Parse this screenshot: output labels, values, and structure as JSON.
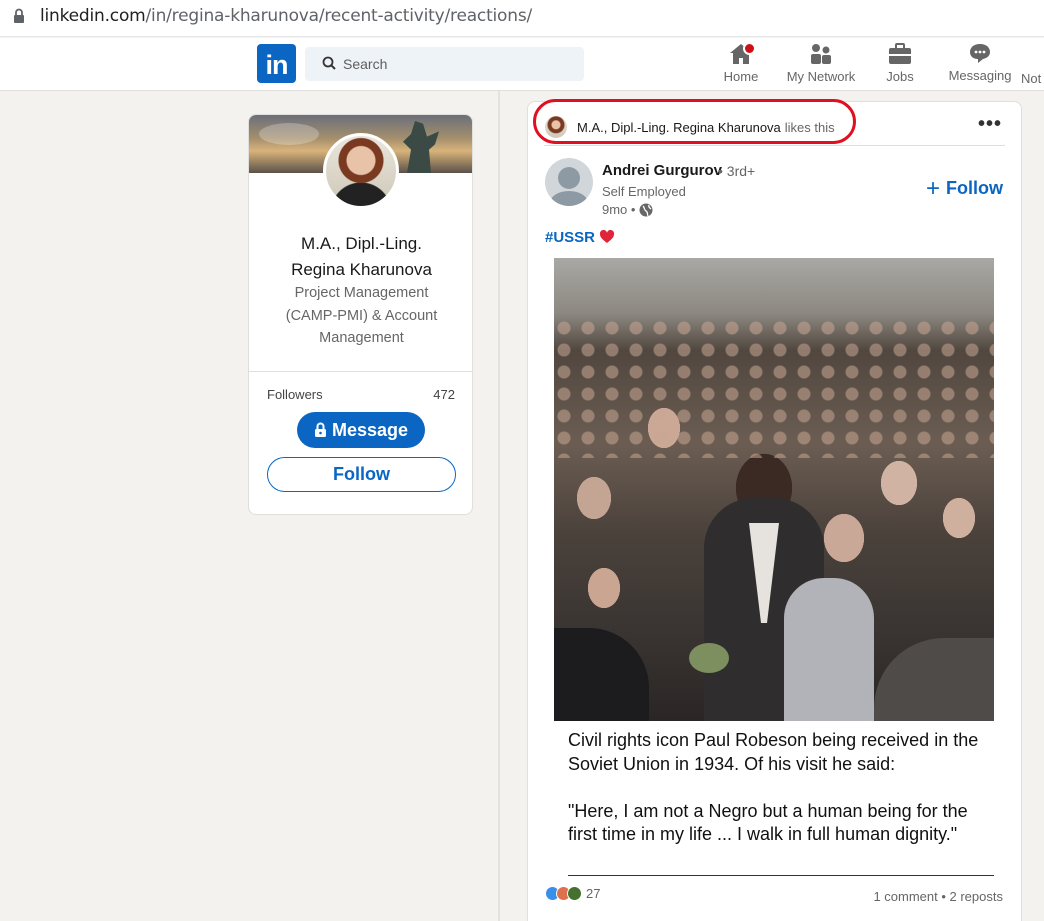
{
  "browser": {
    "url_domain": "linkedin.com",
    "url_path": "/in/regina-kharunova/recent-activity/reactions/"
  },
  "nav": {
    "logo": "in",
    "search_placeholder": "Search",
    "items": [
      {
        "label": "Home",
        "icon": "home-icon"
      },
      {
        "label": "My Network",
        "icon": "network-icon"
      },
      {
        "label": "Jobs",
        "icon": "jobs-icon"
      },
      {
        "label": "Messaging",
        "icon": "messaging-icon"
      },
      {
        "label": "Not",
        "icon": "notifications-icon"
      }
    ]
  },
  "profile": {
    "name_line1": "M.A., Dipl.-Ling.",
    "name_line2": "Regina Kharunova",
    "headline": "Project Management (CAMP-PMI) & Account Management",
    "followers_label": "Followers",
    "followers_count": "472",
    "message_label": "Message",
    "follow_label": "Follow"
  },
  "post": {
    "activity_actor": "M.A., Dipl.-Ling. Regina Kharunova",
    "activity_verb": "likes this",
    "more_label": "•••",
    "author_name": "Andrei Gurgurov",
    "author_degree": "• 3rd+",
    "author_title": "Self Employed",
    "author_time": "9mo •",
    "follow_label": "Follow",
    "hashtag": "#USSR",
    "caption": "Civil rights icon Paul Robeson being received in the Soviet Union in 1934. Of his visit he said:\n\n\"Here, I am not a Negro but a human being for the first time in my life ... I walk in full human dignity.\"",
    "reaction_count": "27",
    "social_counts": "1 comment • 2 reposts"
  },
  "colors": {
    "brand": "#0a66c2",
    "highlight_ring": "#e01020",
    "notification_badge": "#cc1016"
  }
}
